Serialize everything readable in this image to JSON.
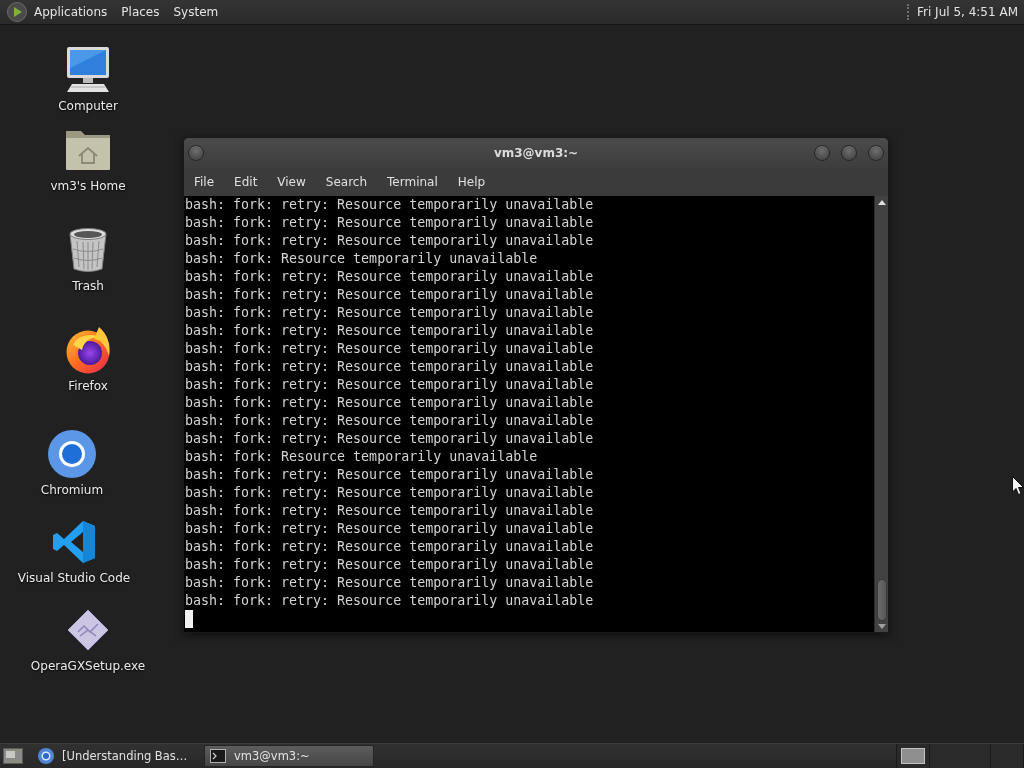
{
  "top_panel": {
    "menus": [
      "Applications",
      "Places",
      "System"
    ],
    "clock": "Fri Jul 5, 4:51 AM"
  },
  "desktop_icons": [
    {
      "label": "Computer",
      "kind": "computer"
    },
    {
      "label": "vm3's Home",
      "kind": "home"
    },
    {
      "label": "Trash",
      "kind": "trash"
    },
    {
      "label": "Firefox",
      "kind": "firefox"
    },
    {
      "label": "Chromium",
      "kind": "chromium"
    },
    {
      "label": "Visual Studio Code",
      "kind": "vscode"
    },
    {
      "label": "OperaGXSetup.exe",
      "kind": "installer"
    }
  ],
  "terminal": {
    "title": "vm3@vm3:~",
    "menu": [
      "File",
      "Edit",
      "View",
      "Search",
      "Terminal",
      "Help"
    ],
    "lines": [
      "bash: fork: retry: Resource temporarily unavailable",
      "bash: fork: retry: Resource temporarily unavailable",
      "bash: fork: retry: Resource temporarily unavailable",
      "bash: fork: Resource temporarily unavailable",
      "bash: fork: retry: Resource temporarily unavailable",
      "bash: fork: retry: Resource temporarily unavailable",
      "bash: fork: retry: Resource temporarily unavailable",
      "bash: fork: retry: Resource temporarily unavailable",
      "bash: fork: retry: Resource temporarily unavailable",
      "bash: fork: retry: Resource temporarily unavailable",
      "bash: fork: retry: Resource temporarily unavailable",
      "bash: fork: retry: Resource temporarily unavailable",
      "bash: fork: retry: Resource temporarily unavailable",
      "bash: fork: retry: Resource temporarily unavailable",
      "bash: fork: Resource temporarily unavailable",
      "bash: fork: retry: Resource temporarily unavailable",
      "bash: fork: retry: Resource temporarily unavailable",
      "bash: fork: retry: Resource temporarily unavailable",
      "bash: fork: retry: Resource temporarily unavailable",
      "bash: fork: retry: Resource temporarily unavailable",
      "bash: fork: retry: Resource temporarily unavailable",
      "bash: fork: retry: Resource temporarily unavailable",
      "bash: fork: retry: Resource temporarily unavailable"
    ]
  },
  "taskbar": {
    "tasks": [
      {
        "label": "[Understanding Bas…",
        "kind": "browser",
        "selected": false
      },
      {
        "label": "vm3@vm3:~",
        "kind": "terminal",
        "selected": true
      }
    ]
  }
}
